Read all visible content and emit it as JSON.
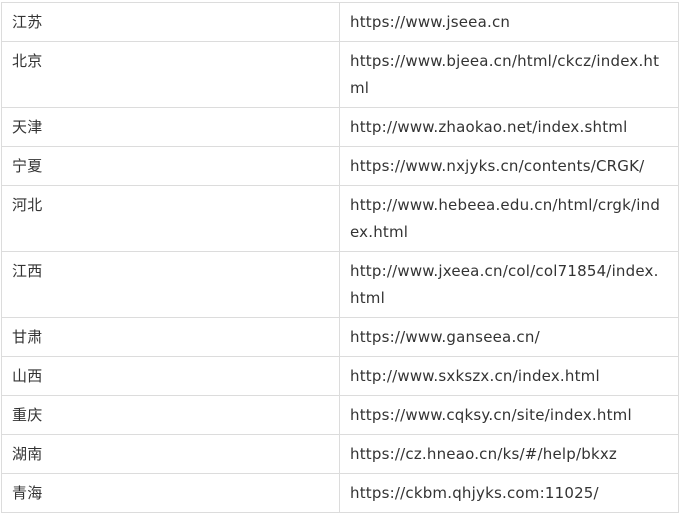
{
  "rows": [
    {
      "region": "江苏",
      "url": "https://www.jseea.cn"
    },
    {
      "region": "北京",
      "url": "https://www.bjeea.cn/html/ckcz/index.html"
    },
    {
      "region": "天津",
      "url": "http://www.zhaokao.net/index.shtml"
    },
    {
      "region": "宁夏",
      "url": "https://www.nxjyks.cn/contents/CRGK/"
    },
    {
      "region": "河北",
      "url": "http://www.hebeea.edu.cn/html/crgk/index.html"
    },
    {
      "region": "江西",
      "url": "http://www.jxeea.cn/col/col71854/index.html"
    },
    {
      "region": "甘肃",
      "url": "https://www.ganseea.cn/"
    },
    {
      "region": "山西",
      "url": "http://www.sxkszx.cn/index.html"
    },
    {
      "region": "重庆",
      "url": "https://www.cqksy.cn/site/index.html"
    },
    {
      "region": "湖南",
      "url": "https://cz.hneao.cn/ks/#/help/bkxz"
    },
    {
      "region": "青海",
      "url": "https://ckbm.qhjyks.com:11025/"
    }
  ]
}
